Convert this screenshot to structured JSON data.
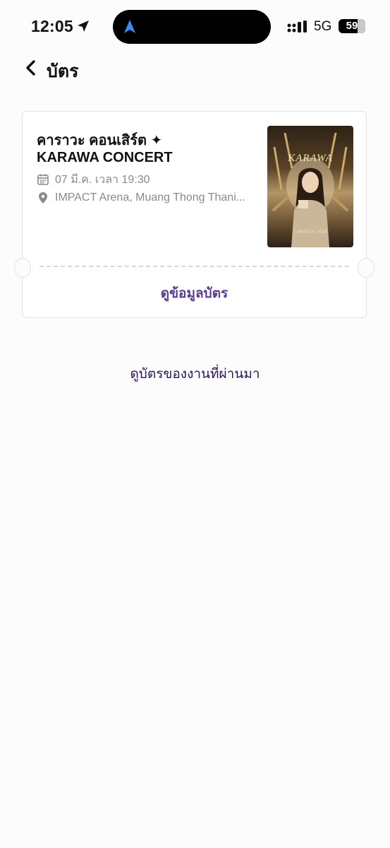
{
  "status_bar": {
    "time": "12:05",
    "network": "5G",
    "battery": "59"
  },
  "header": {
    "title": "บัตร"
  },
  "ticket": {
    "title_th": "คาราวะ คอนเสิร์ต ✦",
    "title_en": "KARAWA CONCERT",
    "date": "07 มี.ค. เวลา 19:30",
    "venue": "IMPACT Arena, Muang Thong Thani...",
    "poster": {
      "brand": "KARAWA",
      "date_text": "7 MARCH 2026"
    },
    "view_button": "ดูข้อมูลบัตร"
  },
  "past_events_link": "ดูบัตรของงานที่ผ่านมา",
  "colors": {
    "accent": "#5a3c93",
    "past_link": "#2a1659",
    "muted": "#8a8a8a"
  }
}
